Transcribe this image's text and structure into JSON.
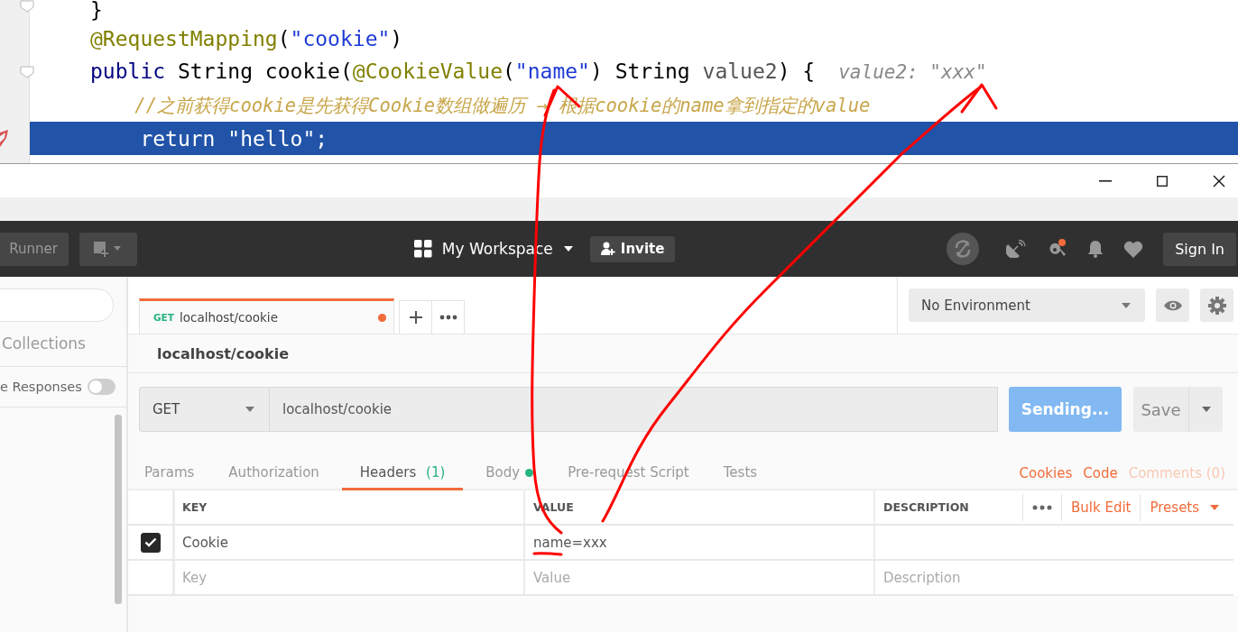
{
  "editor": {
    "lines": [
      {
        "highlighted": false,
        "fold": true,
        "tokens": [
          {
            "kind": "plain",
            "text": "}"
          }
        ]
      },
      {
        "highlighted": false,
        "fold": false,
        "tokens": [
          {
            "kind": "annotation",
            "text": "@RequestMapping"
          },
          {
            "kind": "plain",
            "text": "("
          },
          {
            "kind": "string",
            "text": "\"cookie\""
          },
          {
            "kind": "plain",
            "text": ")"
          }
        ]
      },
      {
        "highlighted": false,
        "fold": true,
        "tokens": [
          {
            "kind": "keyword",
            "text": "public"
          },
          {
            "kind": "plain",
            "text": " String cookie("
          },
          {
            "kind": "annotation",
            "text": "@CookieValue"
          },
          {
            "kind": "plain",
            "text": "("
          },
          {
            "kind": "string",
            "text": "\"name\""
          },
          {
            "kind": "plain",
            "text": ") String "
          },
          {
            "kind": "param",
            "text": "value2"
          },
          {
            "kind": "plain",
            "text": ") {"
          },
          {
            "kind": "hint",
            "text": "value2: \"xxx\""
          }
        ]
      },
      {
        "highlighted": false,
        "fold": false,
        "tokens": [
          {
            "kind": "comment",
            "text": "    //之前获得cookie是先获得Cookie数组做遍历 → 根据cookie的name拿到指定的value"
          }
        ]
      },
      {
        "highlighted": true,
        "fold": false,
        "tokens": [
          {
            "kind": "plain",
            "text": "    return "
          },
          {
            "kind": "plain",
            "text": "\"hello\";"
          }
        ]
      }
    ]
  },
  "header": {
    "runner": "Runner",
    "workspace": "My Workspace",
    "invite": "Invite",
    "sign_in": "Sign In"
  },
  "sidebar": {
    "collections": "Collections",
    "responses_toggle": {
      "label": "e Responses",
      "on": false
    }
  },
  "request_tabs": [
    {
      "method": "GET",
      "title": "localhost/cookie",
      "selected": true,
      "unsaved": true
    }
  ],
  "environment": {
    "value": "No Environment"
  },
  "request": {
    "name": "localhost/cookie",
    "method": "GET",
    "url": "localhost/cookie",
    "send_label": "Sending...",
    "save_label": "Save"
  },
  "sections": [
    {
      "label": "Params",
      "selected": false,
      "dot": false
    },
    {
      "label": "Authorization",
      "selected": false,
      "dot": false
    },
    {
      "label": "Headers",
      "count": "(1)",
      "selected": true,
      "dot": false
    },
    {
      "label": "Body",
      "selected": false,
      "dot": true
    },
    {
      "label": "Pre-request Script",
      "selected": false,
      "dot": false
    },
    {
      "label": "Tests",
      "selected": false,
      "dot": false
    }
  ],
  "links": [
    {
      "label": "Cookies",
      "disabled": false
    },
    {
      "label": "Code",
      "disabled": false
    },
    {
      "label": "Comments (0)",
      "disabled": true
    }
  ],
  "headers_table": {
    "columns": [
      "KEY",
      "VALUE",
      "DESCRIPTION"
    ],
    "bulk_edit": "Bulk Edit",
    "presets": "Presets",
    "rows": [
      {
        "checked": true,
        "key": "Cookie",
        "value": "name=xxx"
      }
    ],
    "new_row": {
      "key_placeholder": "Key",
      "value_placeholder": "Value",
      "description_placeholder": "Description"
    }
  }
}
